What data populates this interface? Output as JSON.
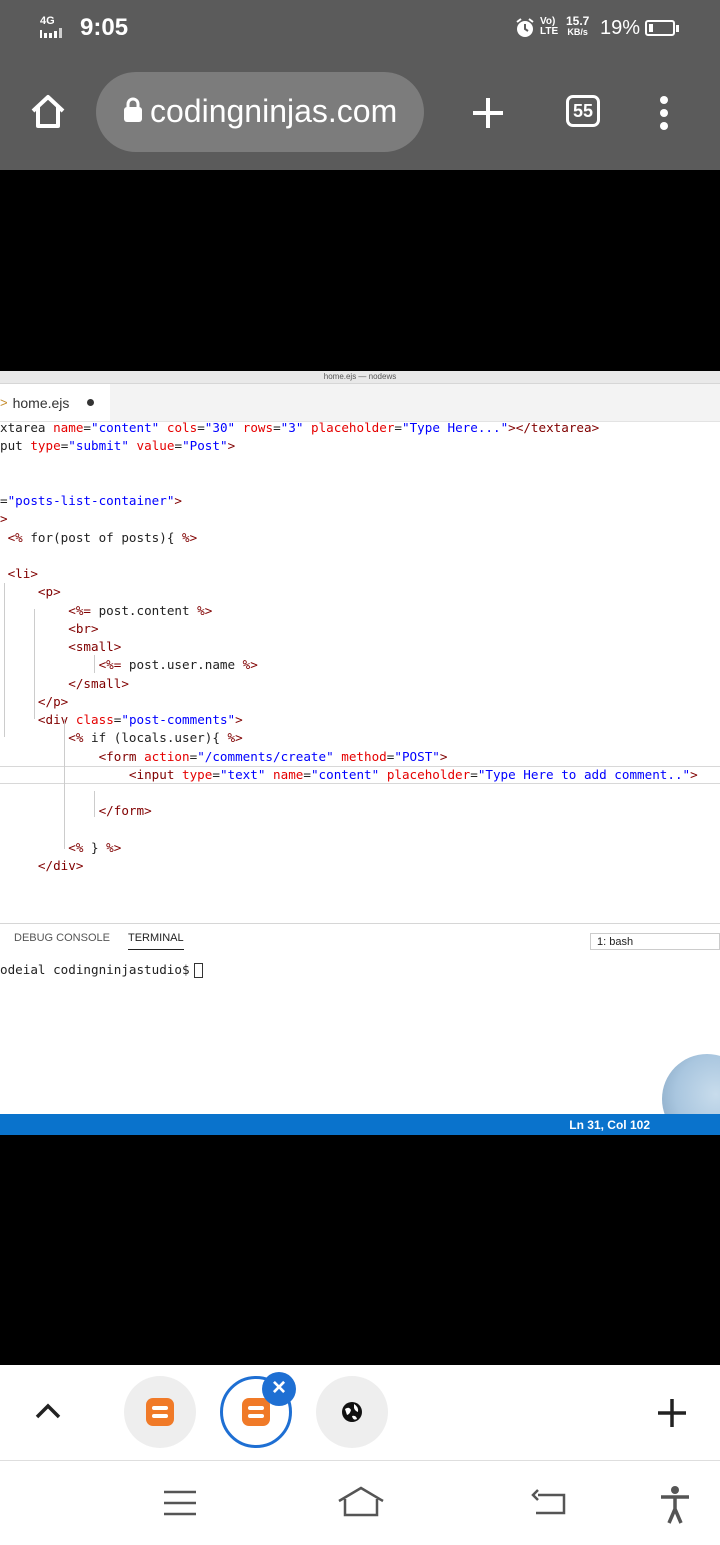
{
  "status_bar": {
    "network": "4G",
    "time": "9:05",
    "volte": "Vo) LTE",
    "speed_value": "15.7",
    "speed_unit": "KB/s",
    "battery_percent": "19%",
    "battery_level": 0.19
  },
  "browser": {
    "url": "codingninjas.com",
    "tab_count": "55"
  },
  "vscode": {
    "window_title": "home.ejs — nodews",
    "tab_label": "home.ejs",
    "code_lines": [
      "xtarea name=\"content\" cols=\"30\" rows=\"3\" placeholder=\"Type Here...\"></textarea>",
      "put type=\"submit\" value=\"Post\">",
      "",
      "",
      "=\"posts-list-container\">",
      ">",
      " <% for(post of posts){ %>",
      "",
      " <li>",
      "     <p>",
      "         <%= post.content %>",
      "         <br>",
      "         <small>",
      "             <%= post.user.name %>",
      "         </small>",
      "     </p>",
      "     <div class=\"post-comments\">",
      "         <% if (locals.user){ %>",
      "             <form action=\"/comments/create\" method=\"POST\">",
      "                 <input type=\"text\" name=\"content\" placeholder=\"Type Here to add comment..\">",
      "",
      "             </form>",
      "",
      "         <% } %>",
      "     </div>"
    ],
    "panel_tabs": [
      "DEBUG CONSOLE",
      "TERMINAL"
    ],
    "terminal_select": "1: bash",
    "terminal_prompt": "odeial codingninjastudio$",
    "cursor_position": "Ln 31, Col 102"
  },
  "colors": {
    "chrome": "#5b5b5b",
    "url_pill": "#7c7c7c",
    "accent_blue": "#1e6fd3",
    "vscode_status": "#0a73cc",
    "coding_ninjas_orange": "#f07a28"
  },
  "tab_strip": {
    "tabs": [
      {
        "icon": "coding-ninjas-icon",
        "active": false
      },
      {
        "icon": "coding-ninjas-icon",
        "active": true
      },
      {
        "icon": "globe-icon",
        "active": false
      }
    ]
  }
}
